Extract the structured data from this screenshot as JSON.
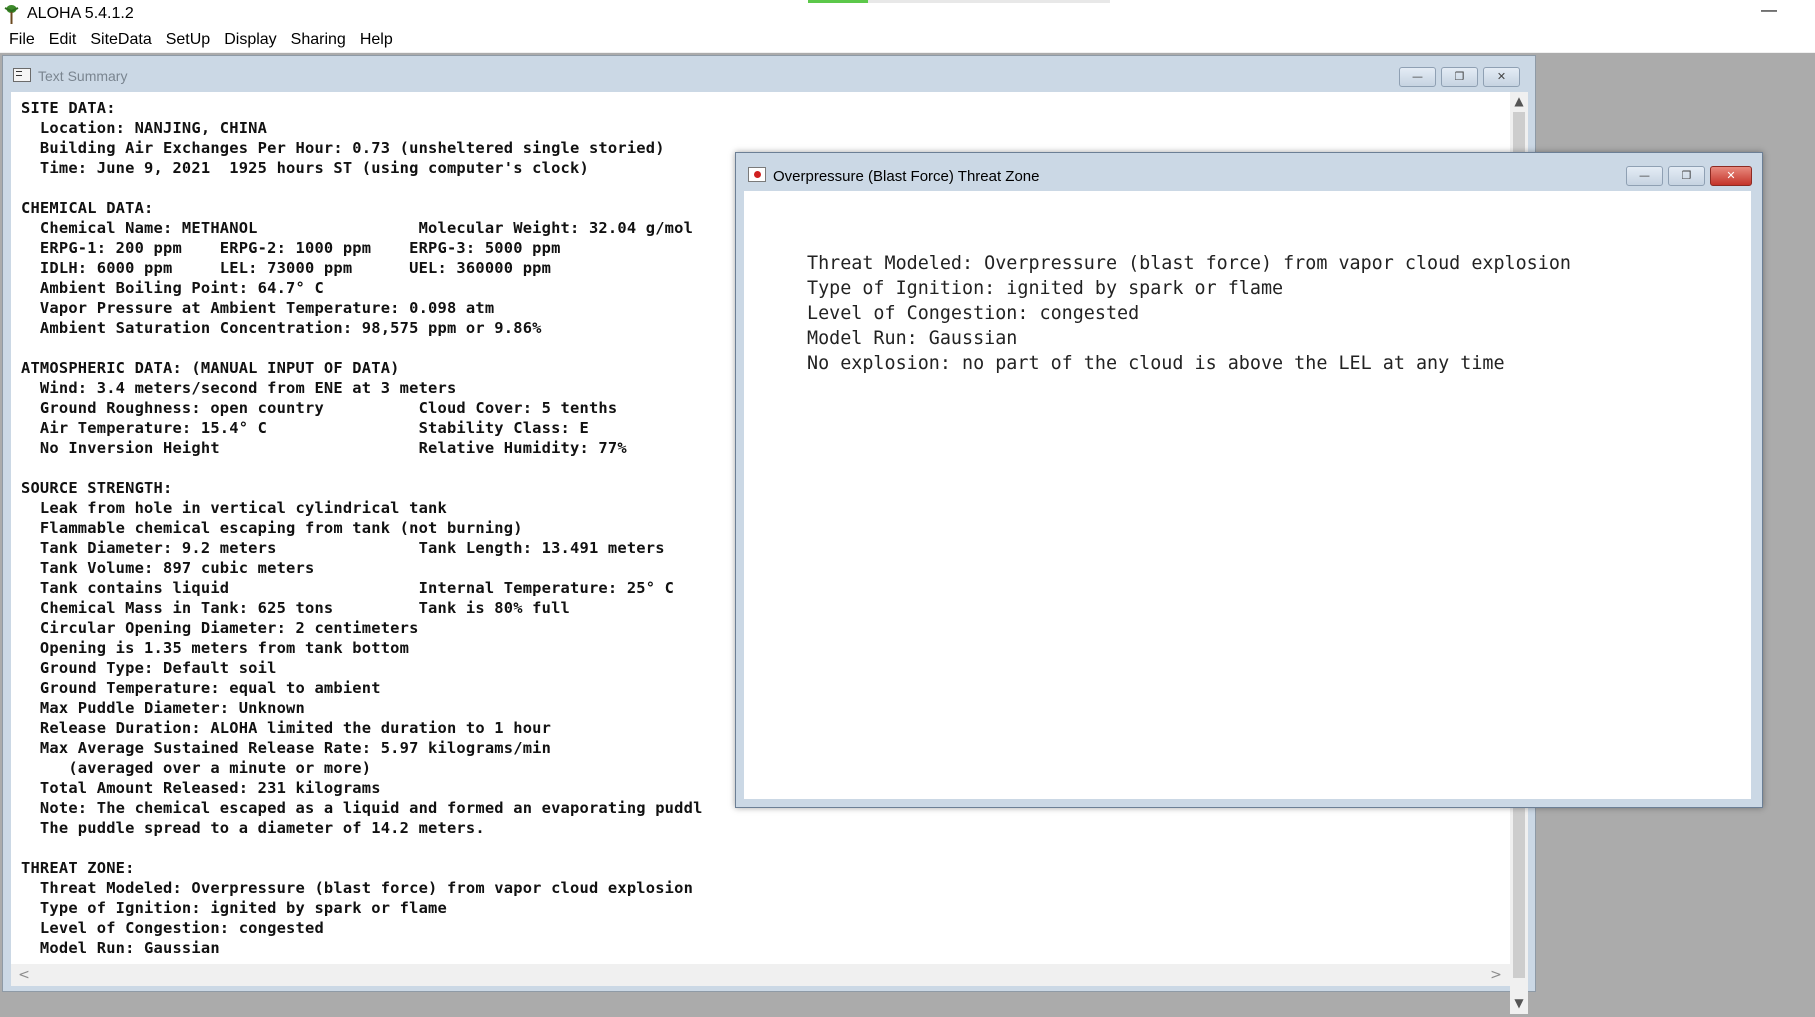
{
  "app": {
    "title": "ALOHA 5.4.1.2",
    "minimize_glyph": "—"
  },
  "menu": {
    "items": [
      "File",
      "Edit",
      "SiteData",
      "SetUp",
      "Display",
      "Sharing",
      "Help"
    ]
  },
  "text_summary": {
    "title": "Text Summary",
    "controls": {
      "minimize": "—",
      "restore": "❐",
      "close": "✕"
    },
    "lines": [
      "SITE DATA:",
      "  Location: NANJING, CHINA",
      "  Building Air Exchanges Per Hour: 0.73 (unsheltered single storied)",
      "  Time: June 9, 2021  1925 hours ST (using computer's clock)",
      "",
      "CHEMICAL DATA:",
      "  Chemical Name: METHANOL                 Molecular Weight: 32.04 g/mol",
      "  ERPG-1: 200 ppm    ERPG-2: 1000 ppm    ERPG-3: 5000 ppm",
      "  IDLH: 6000 ppm     LEL: 73000 ppm      UEL: 360000 ppm",
      "  Ambient Boiling Point: 64.7° C",
      "  Vapor Pressure at Ambient Temperature: 0.098 atm",
      "  Ambient Saturation Concentration: 98,575 ppm or 9.86%",
      "",
      "ATMOSPHERIC DATA: (MANUAL INPUT OF DATA)",
      "  Wind: 3.4 meters/second from ENE at 3 meters",
      "  Ground Roughness: open country          Cloud Cover: 5 tenths",
      "  Air Temperature: 15.4° C                Stability Class: E",
      "  No Inversion Height                     Relative Humidity: 77%",
      "",
      "SOURCE STRENGTH:",
      "  Leak from hole in vertical cylindrical tank",
      "  Flammable chemical escaping from tank (not burning)",
      "  Tank Diameter: 9.2 meters               Tank Length: 13.491 meters",
      "  Tank Volume: 897 cubic meters",
      "  Tank contains liquid                    Internal Temperature: 25° C",
      "  Chemical Mass in Tank: 625 tons         Tank is 80% full",
      "  Circular Opening Diameter: 2 centimeters",
      "  Opening is 1.35 meters from tank bottom",
      "  Ground Type: Default soil",
      "  Ground Temperature: equal to ambient",
      "  Max Puddle Diameter: Unknown",
      "  Release Duration: ALOHA limited the duration to 1 hour",
      "  Max Average Sustained Release Rate: 5.97 kilograms/min",
      "     (averaged over a minute or more)",
      "  Total Amount Released: 231 kilograms",
      "  Note: The chemical escaped as a liquid and formed an evaporating puddl",
      "  The puddle spread to a diameter of 14.2 meters.",
      "",
      "THREAT ZONE:",
      "  Threat Modeled: Overpressure (blast force) from vapor cloud explosion",
      "  Type of Ignition: ignited by spark or flame",
      "  Level of Congestion: congested",
      "  Model Run: Gaussian"
    ],
    "scroll": {
      "up": "▲",
      "down": "▼",
      "left": "<",
      "right": ">"
    }
  },
  "overpressure": {
    "title": "Overpressure (Blast Force) Threat Zone",
    "controls": {
      "minimize": "—",
      "restore": "❐",
      "close": "✕"
    },
    "lines": [
      "Threat Modeled: Overpressure (blast force) from vapor cloud explosion",
      "Type of Ignition: ignited by spark or flame",
      "Level of Congestion: congested",
      "Model Run: Gaussian",
      "No explosion: no part of the cloud is above the LEL at any time"
    ]
  }
}
